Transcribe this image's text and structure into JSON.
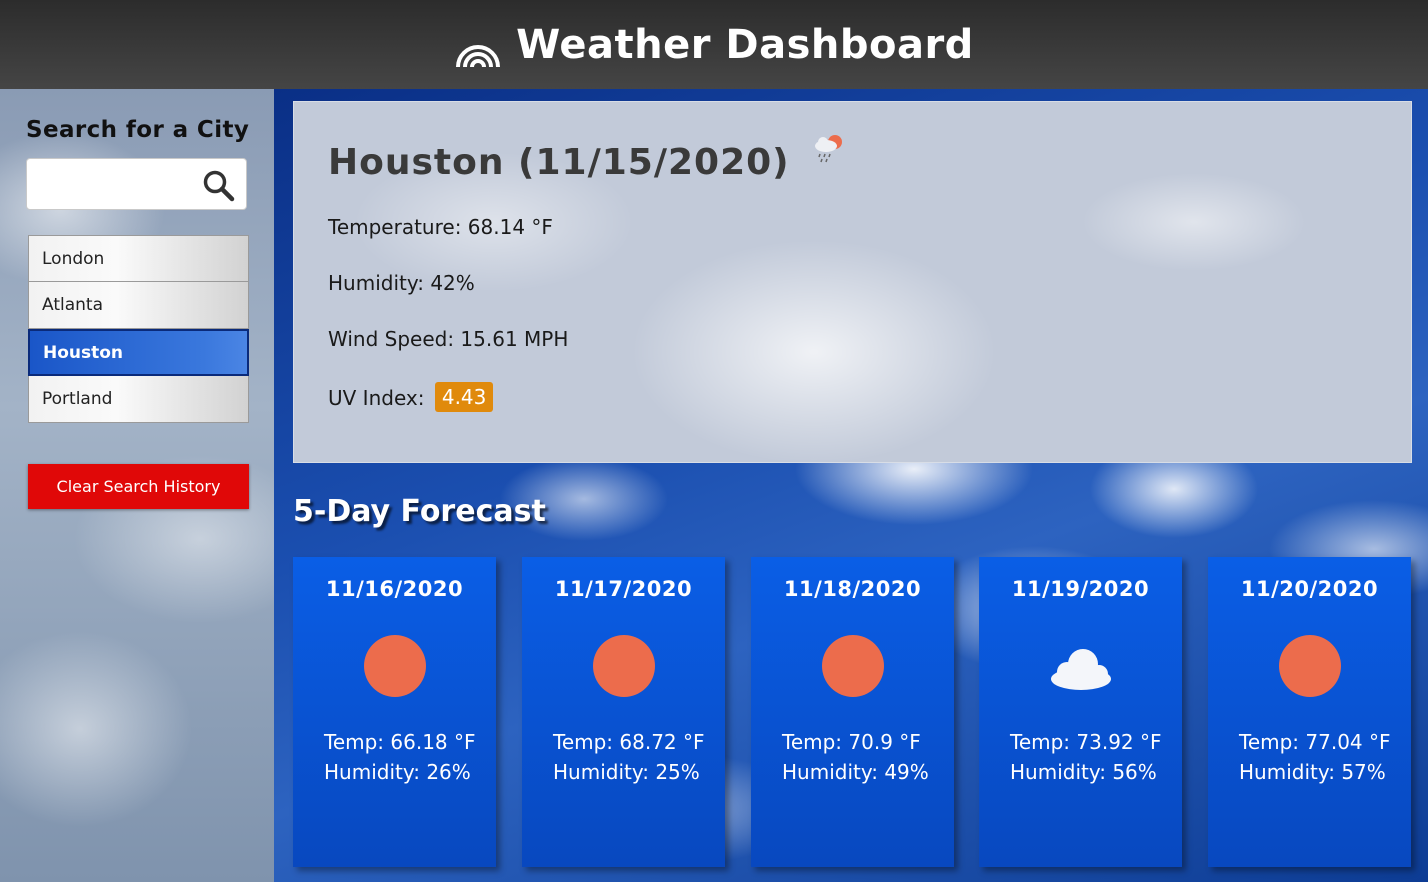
{
  "header": {
    "title": "Weather Dashboard",
    "logo_icon": "rainbow-icon"
  },
  "sidebar": {
    "search_title": "Search for a City",
    "search": {
      "value": "",
      "placeholder": "",
      "icon": "search-icon"
    },
    "history": [
      {
        "label": "London",
        "active": false
      },
      {
        "label": "Atlanta",
        "active": false
      },
      {
        "label": "Houston",
        "active": true
      },
      {
        "label": "Portland",
        "active": false
      }
    ],
    "clear_label": "Clear Search History"
  },
  "current": {
    "heading": "Houston (11/15/2020)",
    "icon": "rain-cloud-sun-icon",
    "temperature": "Temperature: 68.14 °F",
    "humidity": "Humidity: 42%",
    "wind": "Wind Speed: 15.61 MPH",
    "uv_label": "UV Index:",
    "uv_value": "4.43",
    "uv_color": "#e08a0c"
  },
  "forecast": {
    "title": "5-Day Forecast",
    "days": [
      {
        "date": "11/16/2020",
        "icon": "sun-icon",
        "temp": "Temp: 66.18 °F",
        "humidity": "Humidity: 26%"
      },
      {
        "date": "11/17/2020",
        "icon": "sun-icon",
        "temp": "Temp: 68.72 °F",
        "humidity": "Humidity: 25%"
      },
      {
        "date": "11/18/2020",
        "icon": "sun-icon",
        "temp": "Temp: 70.9 °F",
        "humidity": "Humidity: 49%"
      },
      {
        "date": "11/19/2020",
        "icon": "cloud-icon",
        "temp": "Temp: 73.92 °F",
        "humidity": "Humidity: 56%"
      },
      {
        "date": "11/20/2020",
        "icon": "sun-icon",
        "temp": "Temp: 77.04 °F",
        "humidity": "Humidity: 57%"
      }
    ]
  },
  "colors": {
    "clear_button": "#e00808",
    "sun": "#ec6c4c",
    "card": "#0a5ee6",
    "active_city": "#1a56c8"
  }
}
